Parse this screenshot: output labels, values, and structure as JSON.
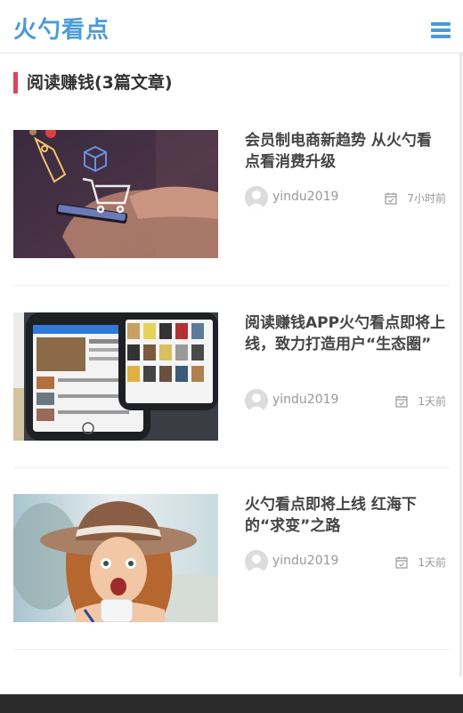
{
  "header": {
    "logo": "火勺看点",
    "menu_icon": "hamburger-menu-icon"
  },
  "section": {
    "title": "阅读赚钱(3篇文章)"
  },
  "posts": [
    {
      "title": "会员制电商新趋势 从火勺看点看消费升级",
      "author": "yindu2019",
      "time": "7小时前",
      "image": "shopping-cart-phone-image"
    },
    {
      "title": "阅读赚钱APP火勺看点即将上线，致力打造用户“生态圈”",
      "author": "yindu2019",
      "time": "1天前",
      "image": "reading-app-phones-image"
    },
    {
      "title": "火勺看点即将上线 红海下的“求变”之路",
      "author": "yindu2019",
      "time": "1天前",
      "image": "surprised-woman-hat-image"
    }
  ],
  "colors": {
    "brand": "#4a9bd8",
    "accent_bar": "#e0435a",
    "footer": "#2a2a2a"
  }
}
